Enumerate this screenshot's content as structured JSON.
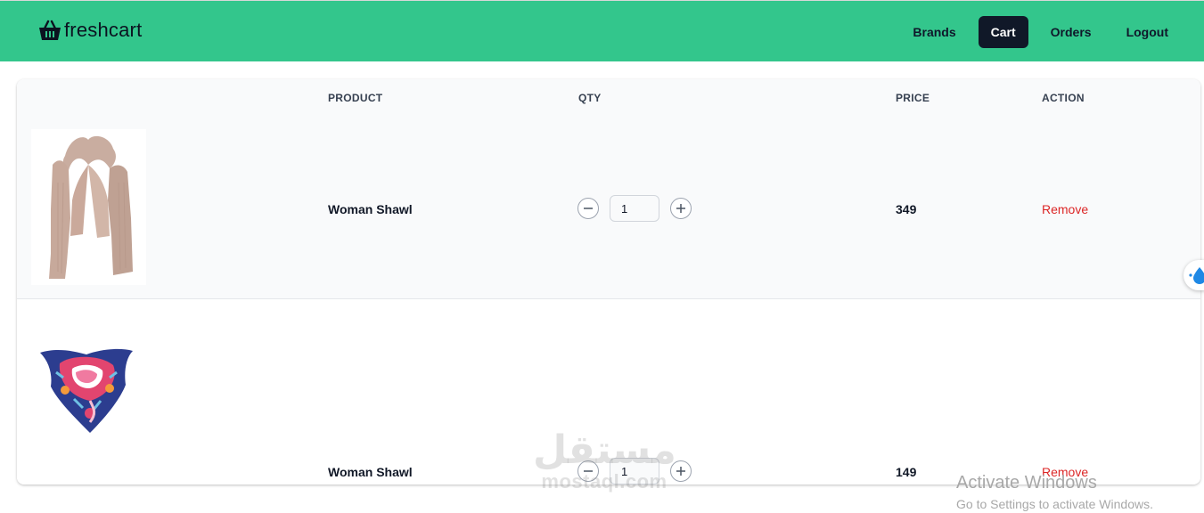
{
  "navbar": {
    "brand": "freshcart",
    "links": [
      {
        "label": "Brands",
        "active": false
      },
      {
        "label": "Cart",
        "active": true
      },
      {
        "label": "Orders",
        "active": false
      },
      {
        "label": "Logout",
        "active": false
      }
    ],
    "brand_color": "#33c68c"
  },
  "cart": {
    "headers": {
      "product": "PRODUCT",
      "qty": "QTY",
      "price": "PRICE",
      "action": "ACTION"
    },
    "items": [
      {
        "name": "Woman Shawl",
        "quantity": "1",
        "price": "349",
        "action": "Remove",
        "image_icon": "beige-shawl-image"
      },
      {
        "name": "Woman Shawl",
        "quantity": "1",
        "price": "149",
        "action": "Remove",
        "image_icon": "printed-scarf-image"
      }
    ]
  },
  "watermark": {
    "arabic": "مستقل",
    "latin": "mostaql.com"
  },
  "os_notice": {
    "title": "Activate Windows",
    "subtitle": "Go to Settings to activate Windows."
  }
}
